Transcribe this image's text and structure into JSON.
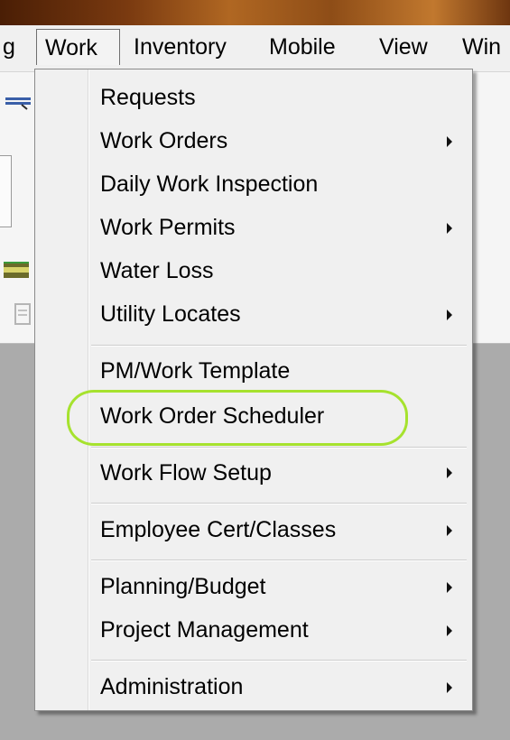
{
  "menubar": {
    "items": [
      {
        "label": "g"
      },
      {
        "label": "Work"
      },
      {
        "label": "Inventory"
      },
      {
        "label": "Mobile"
      },
      {
        "label": "View"
      },
      {
        "label": "Win"
      }
    ]
  },
  "work_menu": {
    "groups": [
      [
        {
          "label": "Requests",
          "submenu": false
        },
        {
          "label": "Work Orders",
          "submenu": true
        },
        {
          "label": "Daily Work Inspection",
          "submenu": false
        },
        {
          "label": "Work Permits",
          "submenu": true
        },
        {
          "label": "Water Loss",
          "submenu": false
        },
        {
          "label": "Utility Locates",
          "submenu": true
        }
      ],
      [
        {
          "label": "PM/Work Template",
          "submenu": false
        },
        {
          "label": "Work Order Scheduler",
          "submenu": false,
          "highlighted": true
        }
      ],
      [
        {
          "label": "Work Flow Setup",
          "submenu": true
        }
      ],
      [
        {
          "label": "Employee Cert/Classes",
          "submenu": true
        }
      ],
      [
        {
          "label": "Planning/Budget",
          "submenu": true
        },
        {
          "label": "Project Management",
          "submenu": true
        }
      ],
      [
        {
          "label": "Administration",
          "submenu": true
        }
      ]
    ]
  },
  "colors": {
    "highlight_ring": "#a6e22e",
    "menu_background": "#f0f0f0",
    "workspace_background": "#ababab"
  }
}
